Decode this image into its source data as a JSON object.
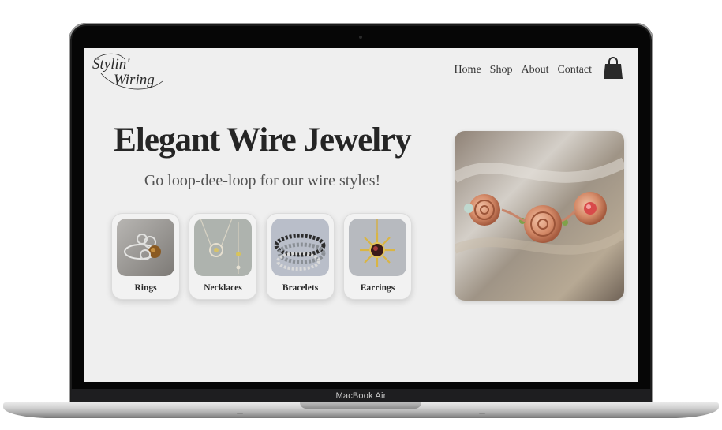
{
  "device": {
    "label": "MacBook Air"
  },
  "site": {
    "logo_line1": "Stylin'",
    "logo_line2": "Wiring"
  },
  "nav": {
    "items": [
      "Home",
      "Shop",
      "About",
      "Contact"
    ],
    "cart_icon": "shopping-bag-icon"
  },
  "hero": {
    "title": "Elegant Wire Jewelry",
    "subtitle": "Go loop-dee-loop for our wire styles!"
  },
  "categories": [
    {
      "label": "Rings"
    },
    {
      "label": "Necklaces"
    },
    {
      "label": "Bracelets"
    },
    {
      "label": "Earrings"
    }
  ],
  "colors": {
    "screen_bg": "#efefef",
    "text_dark": "#252525",
    "copper": "#c8785a"
  }
}
